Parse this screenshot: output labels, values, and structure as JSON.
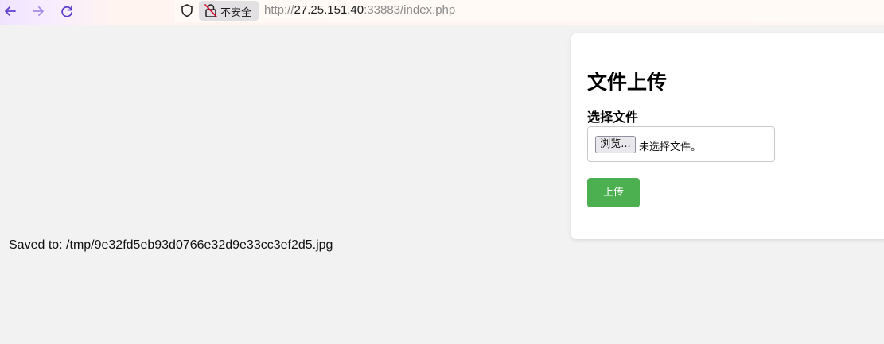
{
  "browser": {
    "security_label": "不安全",
    "url_scheme": "http://",
    "url_host": "27.25.151.40",
    "url_rest": ":33883/index.php"
  },
  "upload_form": {
    "title": "文件上传",
    "file_label": "选择文件",
    "browse_button": "浏览...",
    "file_status": "未选择文件。",
    "submit_button": "上传"
  },
  "status": {
    "saved_message": "Saved to: /tmp/9e32fd5eb93d0766e32d9e33cc3ef2d5.jpg"
  },
  "colors": {
    "upload_button": "#4caf50",
    "page_background": "#f2f2f2",
    "card_background": "#ffffff"
  }
}
